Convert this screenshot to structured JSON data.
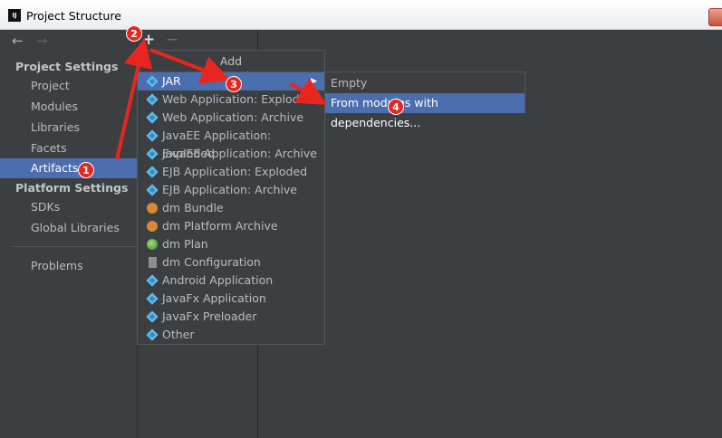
{
  "window": {
    "title": "Project Structure",
    "app_icon": "intellij-icon"
  },
  "sidebar": {
    "project_settings_header": "Project Settings",
    "project_settings": [
      "Project",
      "Modules",
      "Libraries",
      "Facets",
      "Artifacts"
    ],
    "selected": "Artifacts",
    "platform_settings_header": "Platform Settings",
    "platform_settings": [
      "SDKs",
      "Global Libraries"
    ],
    "other": [
      "Problems"
    ]
  },
  "toolbar": {
    "add": "+",
    "remove": "−"
  },
  "add_menu": {
    "header": "Add",
    "items": [
      {
        "label": "JAR",
        "icon": "diamond-icon"
      },
      {
        "label": "Web Application: Exploded",
        "icon": "diamond-icon"
      },
      {
        "label": "Web Application: Archive",
        "icon": "diamond-icon"
      },
      {
        "label": "JavaEE Application: Exploded",
        "icon": "diamond-icon"
      },
      {
        "label": "JavaEE Application: Archive",
        "icon": "diamond-icon"
      },
      {
        "label": "EJB Application: Exploded",
        "icon": "diamond-icon"
      },
      {
        "label": "EJB Application: Archive",
        "icon": "diamond-icon"
      },
      {
        "label": "dm Bundle",
        "icon": "bundle-icon"
      },
      {
        "label": "dm Platform Archive",
        "icon": "bundle-icon"
      },
      {
        "label": "dm Plan",
        "icon": "plan-icon"
      },
      {
        "label": "dm Configuration",
        "icon": "document-icon"
      },
      {
        "label": "Android Application",
        "icon": "diamond-icon"
      },
      {
        "label": "JavaFx Application",
        "icon": "diamond-icon"
      },
      {
        "label": "JavaFx Preloader",
        "icon": "diamond-icon"
      },
      {
        "label": "Other",
        "icon": "diamond-icon"
      }
    ]
  },
  "jar_submenu": {
    "items": [
      "Empty",
      "From modules with dependencies..."
    ]
  },
  "annotations": [
    "1",
    "2",
    "3",
    "4"
  ],
  "colors": {
    "background": "#3c3f41",
    "selection": "#4b6eaf",
    "annotation": "#e8261f"
  }
}
